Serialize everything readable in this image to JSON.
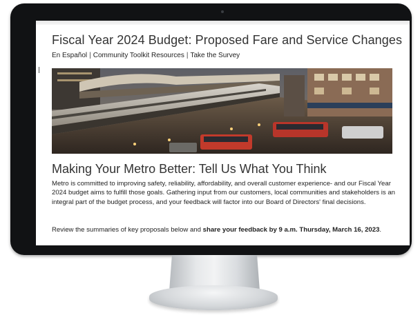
{
  "page": {
    "title": "Fiscal Year 2024 Budget: Proposed Fare and Service Changes",
    "links": [
      {
        "label": "En Español"
      },
      {
        "label": "Community Toolkit Resources"
      },
      {
        "label": "Take the Survey"
      }
    ],
    "link_separator": "|",
    "section_title": "Making Your Metro Better: Tell Us What You Think",
    "paragraph": "Metro is committed to improving safety, reliability, affordability, and overall customer experience- and our Fiscal Year 2024 budget aims to fulfill those goals. Gathering input from our customers, local communities and stakeholders is an integral part of the budget process, and your feedback will factor into our Board of Directors' final decisions.",
    "review_text_start": "Review the summaries of key proposals below and ",
    "review_text_bold": "share your feedback by 9 a.m. Thursday, March 16, 2023",
    "review_text_end": "."
  },
  "colors": {
    "bezel": "#111214",
    "title_text": "#333333",
    "body_text": "#222222",
    "bus_red": "#c23a2b"
  },
  "hero": {
    "icon": "transit-station-photo"
  }
}
